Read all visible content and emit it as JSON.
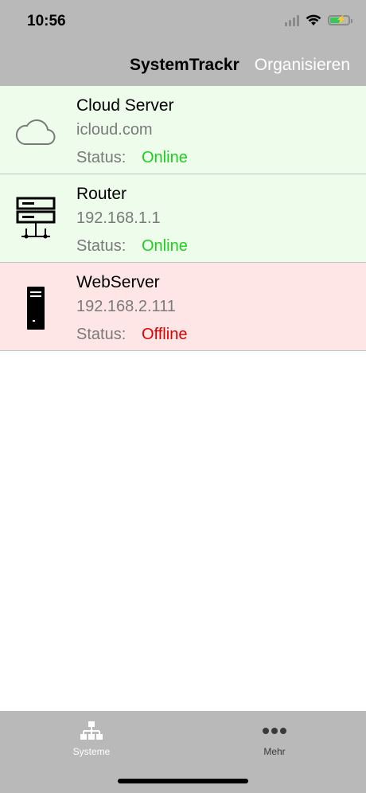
{
  "status_bar": {
    "time": "10:56"
  },
  "nav": {
    "title": "SystemTrackr",
    "action": "Organisieren"
  },
  "systems": [
    {
      "icon": "cloud-icon",
      "name": "Cloud Server",
      "host": "icloud.com",
      "status_label": "Status:",
      "status": "Online",
      "status_color": "#1ecf1e",
      "bg": "#eefcec"
    },
    {
      "icon": "router-icon",
      "name": "Router",
      "host": "192.168.1.1",
      "status_label": "Status:",
      "status": "Online",
      "status_color": "#1ecf1e",
      "bg": "#eefcec"
    },
    {
      "icon": "server-tower-icon",
      "name": "WebServer",
      "host": "192.168.2.111",
      "status_label": "Status:",
      "status": "Offline",
      "status_color": "#e00000",
      "bg": "#ffe6e6"
    }
  ],
  "tabs": [
    {
      "icon": "network-icon",
      "label": "Systeme",
      "selected": true
    },
    {
      "icon": "more-dots-icon",
      "label": "Mehr",
      "selected": false
    }
  ]
}
